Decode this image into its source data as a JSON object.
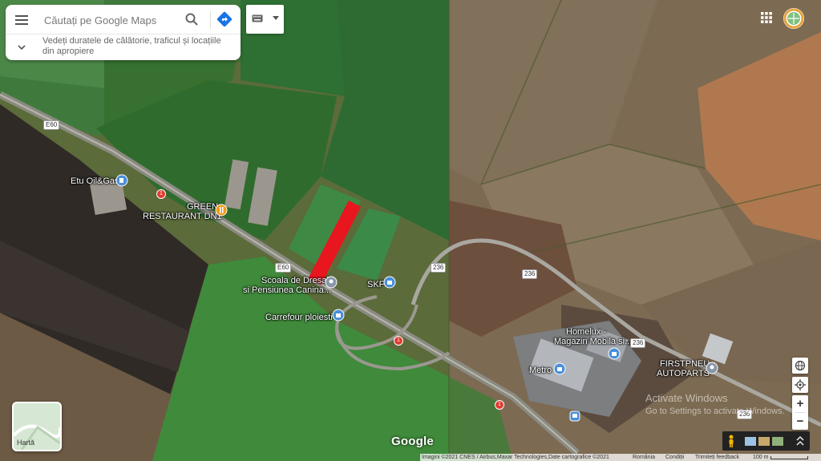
{
  "search": {
    "placeholder": "Căutați pe Google Maps",
    "hint": "Vedeți duratele de călătorie, traficul și locațiile din apropiere"
  },
  "places": {
    "etu_oil": "Etu Oil&Gas",
    "green_restaurant_line1": "GREEN",
    "green_restaurant_line2": "RESTAURANT DN1",
    "scoala_line1": "Scoala de Dresaj",
    "scoala_line2": "si Pensiunea Canina...",
    "skf": "SKF",
    "carrefour": "Carrefour ploiesti",
    "homelux_line1": "Homelux -",
    "homelux_line2": "Magazin Mobila si...",
    "metro": "Metro",
    "firstpneu_line1": "FIRSTPNEU",
    "firstpneu_line2": "AUTOPARTS"
  },
  "roads": {
    "e60_a": "E60",
    "e60_b": "E60",
    "r236_a": "236",
    "r236_b": "236",
    "r236_c": "236",
    "r236_d": "236",
    "dn1_a": "1",
    "dn1_b": "1",
    "dn1_c": "1"
  },
  "layer": {
    "label": "Hartă"
  },
  "controls": {
    "zoom_in": "+",
    "zoom_out": "−"
  },
  "google_logo": "Google",
  "footer": {
    "imagery": "Imagini ©2021 CNES / Airbus,Maxar Technologies,Date cartografice ©2021",
    "country": "România",
    "terms": "Condiții",
    "feedback": "Trimiteți feedback",
    "scale": "100 m"
  },
  "watermark": {
    "line1": "Activate Windows",
    "line2": "Go to Settings to activate Windows."
  },
  "colors": {
    "highlight": "#e8161e",
    "pin_blue": "#4a8fd8",
    "pin_orange": "#f09a1a",
    "directions": "#1a73e8"
  },
  "icons": {
    "menu": "hamburger-icon",
    "search": "search-icon",
    "directions": "directions-icon",
    "keyboard": "keyboard-icon",
    "apps": "apps-grid-icon",
    "globe": "globe-icon",
    "location": "my-location-icon",
    "pegman": "pegman-icon"
  }
}
